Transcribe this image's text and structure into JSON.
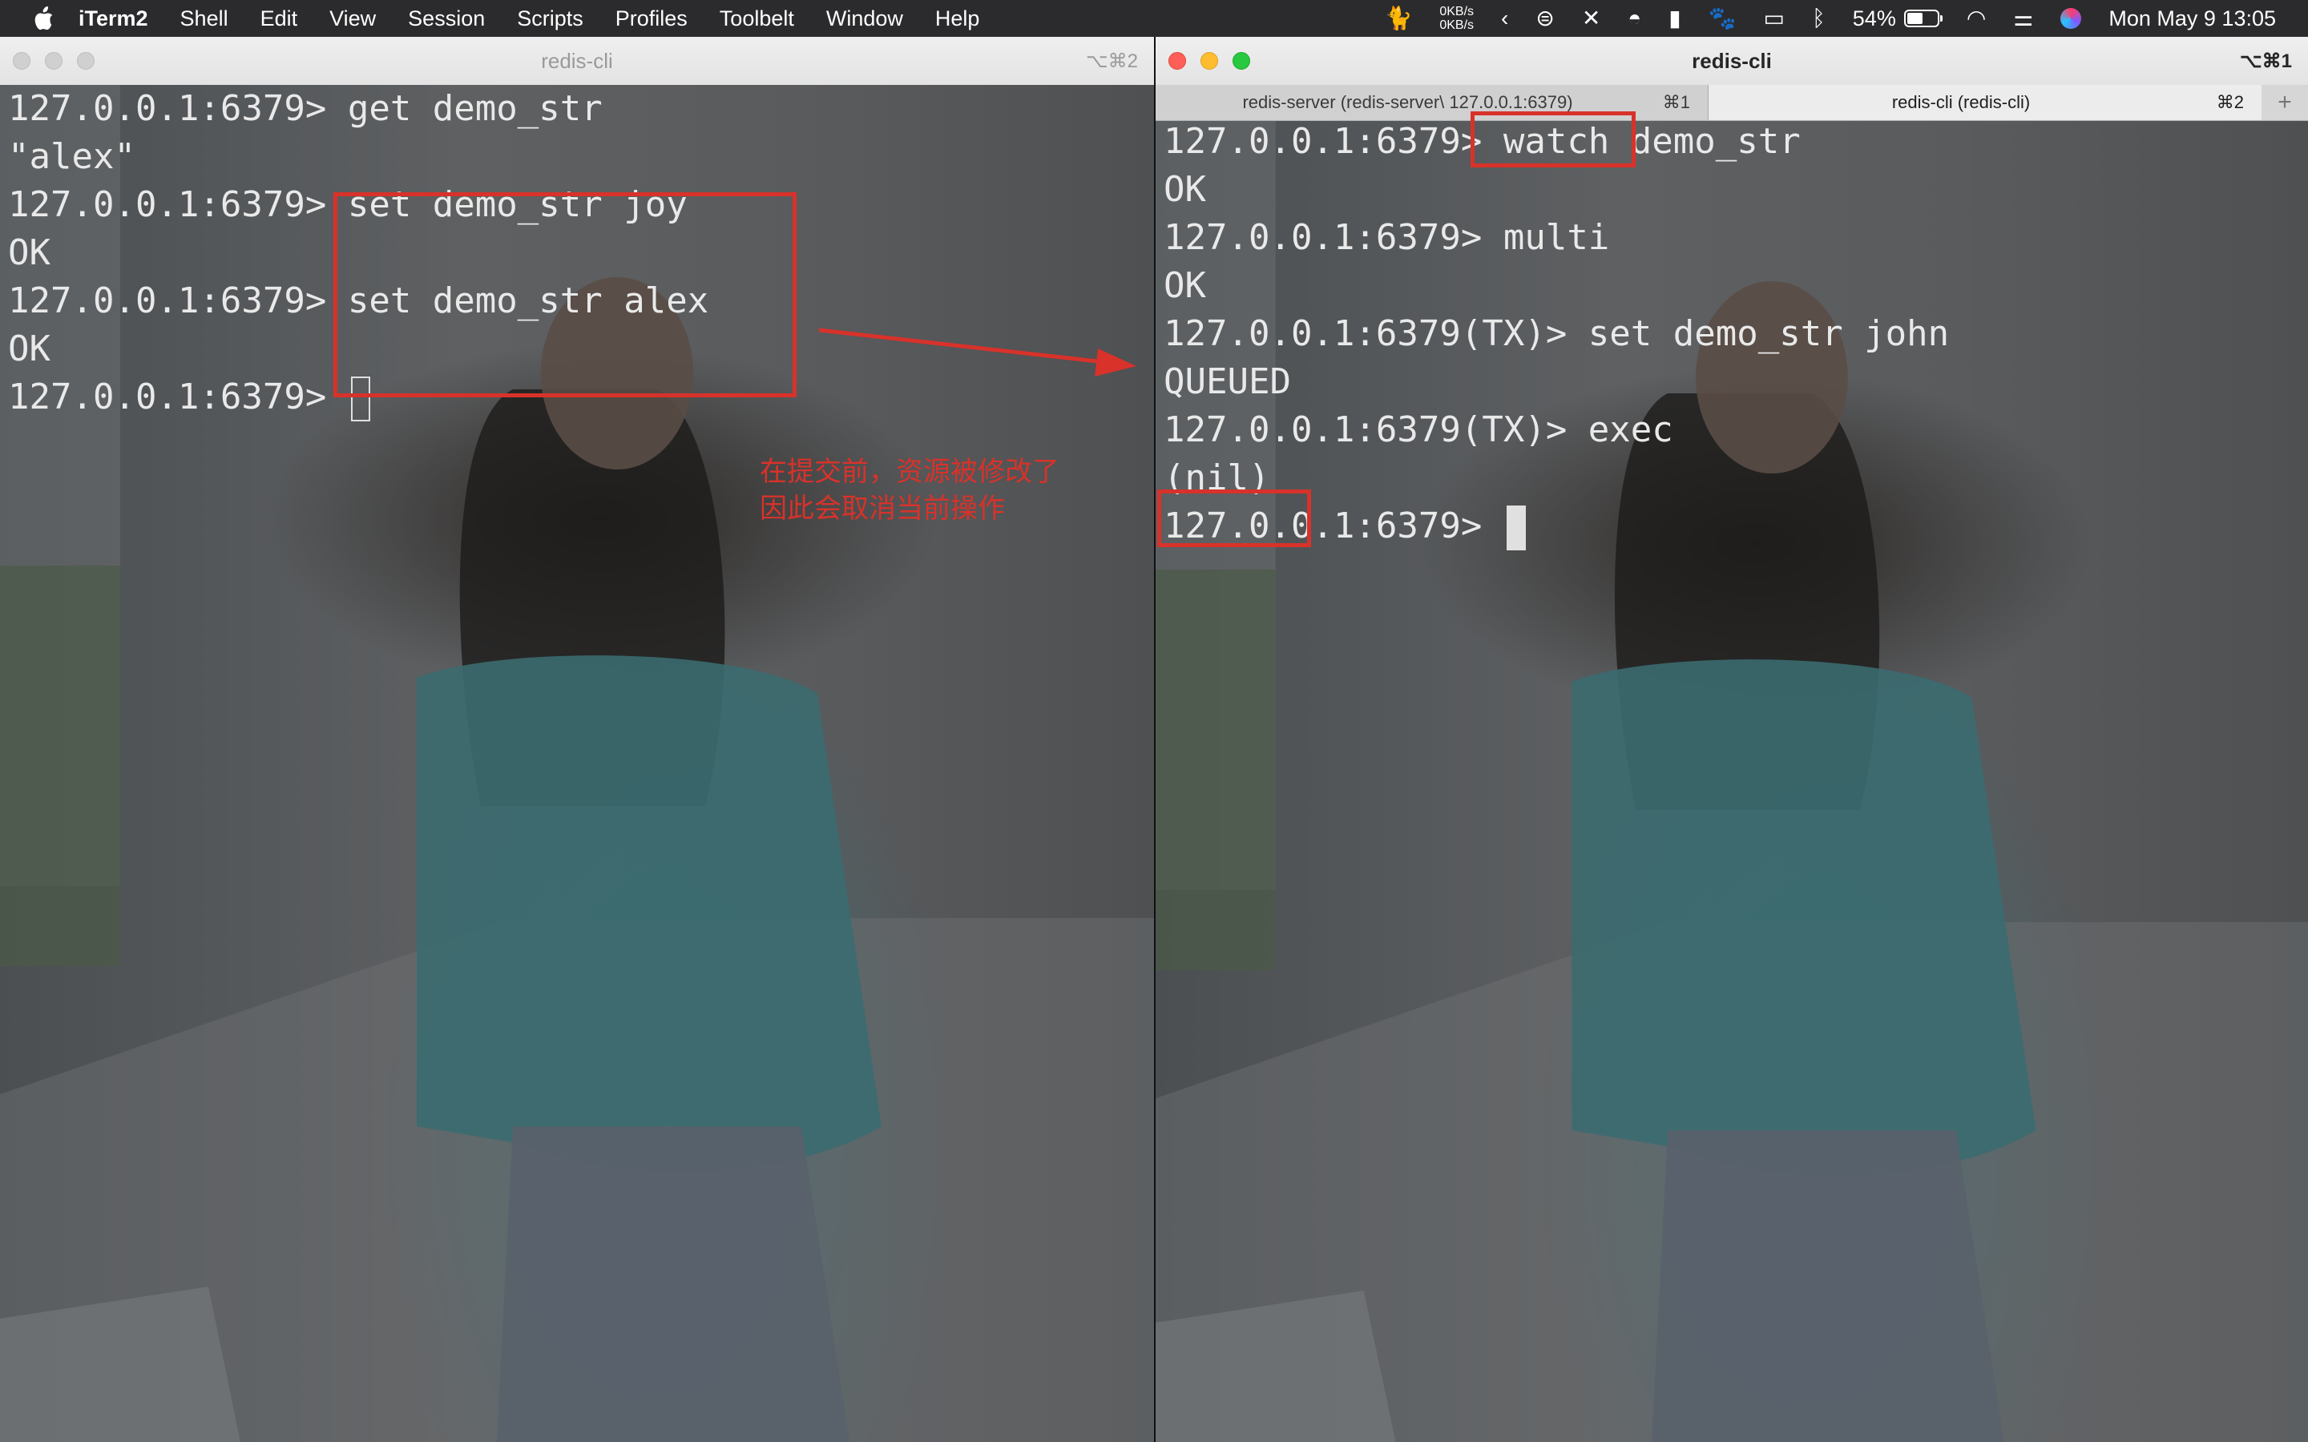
{
  "menubar": {
    "app_name": "iTerm2",
    "menus": [
      "Shell",
      "Edit",
      "View",
      "Session",
      "Scripts",
      "Profiles",
      "Toolbelt",
      "Window",
      "Help"
    ],
    "net_up": "0KB/s",
    "net_down": "0KB/s",
    "battery_percent": "54%",
    "battery_level": 0.54,
    "datetime": "Mon May 9  13:05"
  },
  "left_window": {
    "title": "redis-cli",
    "shortcut": "⌥⌘2",
    "lines": [
      "127.0.0.1:6379> get demo_str",
      "\"alex\"",
      "127.0.0.1:6379> set demo_str joy",
      "OK",
      "127.0.0.1:6379> set demo_str alex",
      "OK",
      "127.0.0.1:6379> "
    ],
    "annotation_line1": "在提交前，资源被修改了",
    "annotation_line2": "因此会取消当前操作"
  },
  "right_window": {
    "title": "redis-cli",
    "shortcut": "⌥⌘1",
    "tabs": [
      {
        "title": "redis-server (redis-server\\ 127.0.0.1:6379)",
        "key": "⌘1"
      },
      {
        "title": "redis-cli (redis-cli)",
        "key": "⌘2"
      }
    ],
    "new_tab": "+",
    "lines": [
      "127.0.0.1:6379> watch demo_str",
      "OK",
      "127.0.0.1:6379> multi",
      "OK",
      "127.0.0.1:6379(TX)> set demo_str john",
      "QUEUED",
      "127.0.0.1:6379(TX)> exec",
      "(nil)",
      "127.0.0.1:6379> "
    ]
  },
  "colors": {
    "annotation": "#d8322a",
    "terminal_text": "#e9e9e9"
  }
}
